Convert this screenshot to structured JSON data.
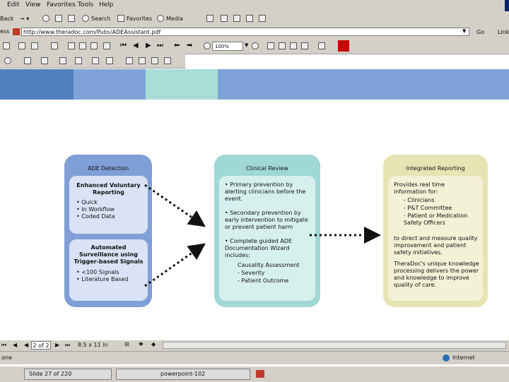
{
  "menu": [
    "Edit",
    "View",
    "Favorites",
    "Tools",
    "Help"
  ],
  "toolbar": {
    "back_label": "Back",
    "search_label": "Search",
    "favorites_label": "Favorites",
    "media_label": "Media"
  },
  "address": {
    "label": "ess",
    "url": "http://www.theradoc.com/Pubs/ADEAssistant.pdf",
    "go_label": "Go",
    "links_label": "Links"
  },
  "pdf_toolbar": {
    "zoom": "100%"
  },
  "colors": {
    "band1": "#4f7fbe",
    "band2": "#7fa3d9",
    "band3": "#a8ddd8",
    "band4": "#7fa3d9",
    "detection_panel": "#7f9fd6",
    "review_panel": "#9fd8d4",
    "reporting_panel": "#e7e4b4"
  },
  "diagram": {
    "detection": {
      "title": "ADE Detection",
      "box1_title": "Enhanced Voluntary Reporting",
      "box1_items": [
        "Quick",
        "In Workflow",
        "Coded Data"
      ],
      "box2_title": "Automated Surveillance using Trigger-based Signals",
      "box2_items": [
        "<100 Signals",
        "Literature Based"
      ]
    },
    "review": {
      "title": "Clinical Review",
      "p1": "Primary prevention by alerting clinicians before the event.",
      "p2": "Secondary prevention by early intervention to mitigate or prevent patient harm",
      "p3": "Complete guided ADE Documentation Wizard includes:",
      "sub1": "Causality Assessment",
      "sub2": "- Severity",
      "sub3": "- Patient Outcome"
    },
    "reporting": {
      "title": "Integrated Reporting",
      "intro": "Provides real time information for:",
      "items": [
        "- Clinicians",
        "- P&T Committee",
        "- Patient or Medication Safety Officers"
      ],
      "para2": "to direct and measure quality improvement and patient safety initiatives.",
      "para3": "TheraDoc's unique knowledge processing delivers the power and knowledge to improve quality of care."
    }
  },
  "nav": {
    "page": "2 of 2",
    "size": "8.5 x 11 in"
  },
  "status": {
    "left": "one",
    "zone": "Internet"
  },
  "taskbar": {
    "item1": "Slide 27 of 220",
    "item2": "powerpoint-102"
  }
}
